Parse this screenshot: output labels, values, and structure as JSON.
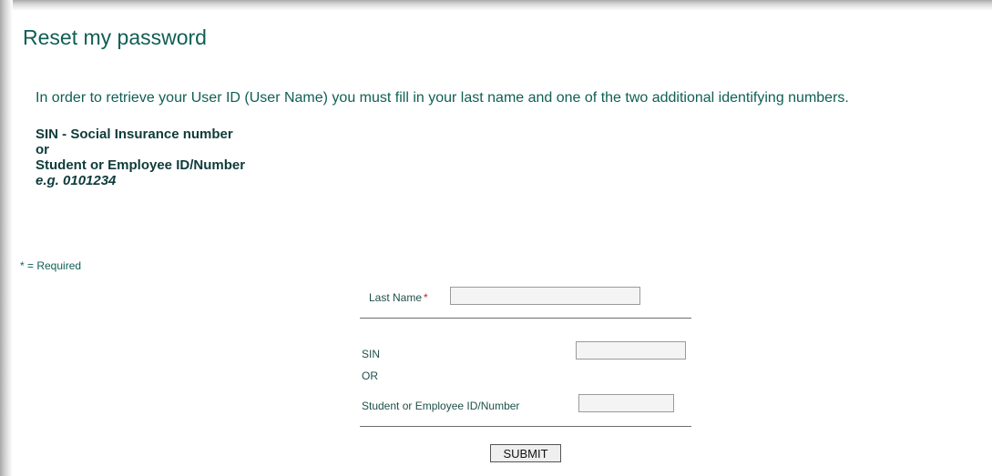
{
  "page": {
    "title": "Reset my password",
    "intro": "In order to retrieve your User ID (User Name) you must fill in your last name and one of the two additional identifying numbers.",
    "id_types": {
      "sin": "SIN - Social Insurance number",
      "or": "or",
      "student": "Student or Employee ID/Number",
      "example": "e.g. 0101234"
    },
    "required_note": "* = Required"
  },
  "form": {
    "last_name_label": "Last Name",
    "required_marker": "*",
    "last_name_value": "",
    "sin_label": "SIN",
    "sin_value": "",
    "or_label": "OR",
    "student_id_label": "Student or Employee ID/Number",
    "student_id_value": "",
    "submit_label": "SUBMIT"
  },
  "colors": {
    "heading": "#0f5f55",
    "required_star": "#c81e1e"
  }
}
